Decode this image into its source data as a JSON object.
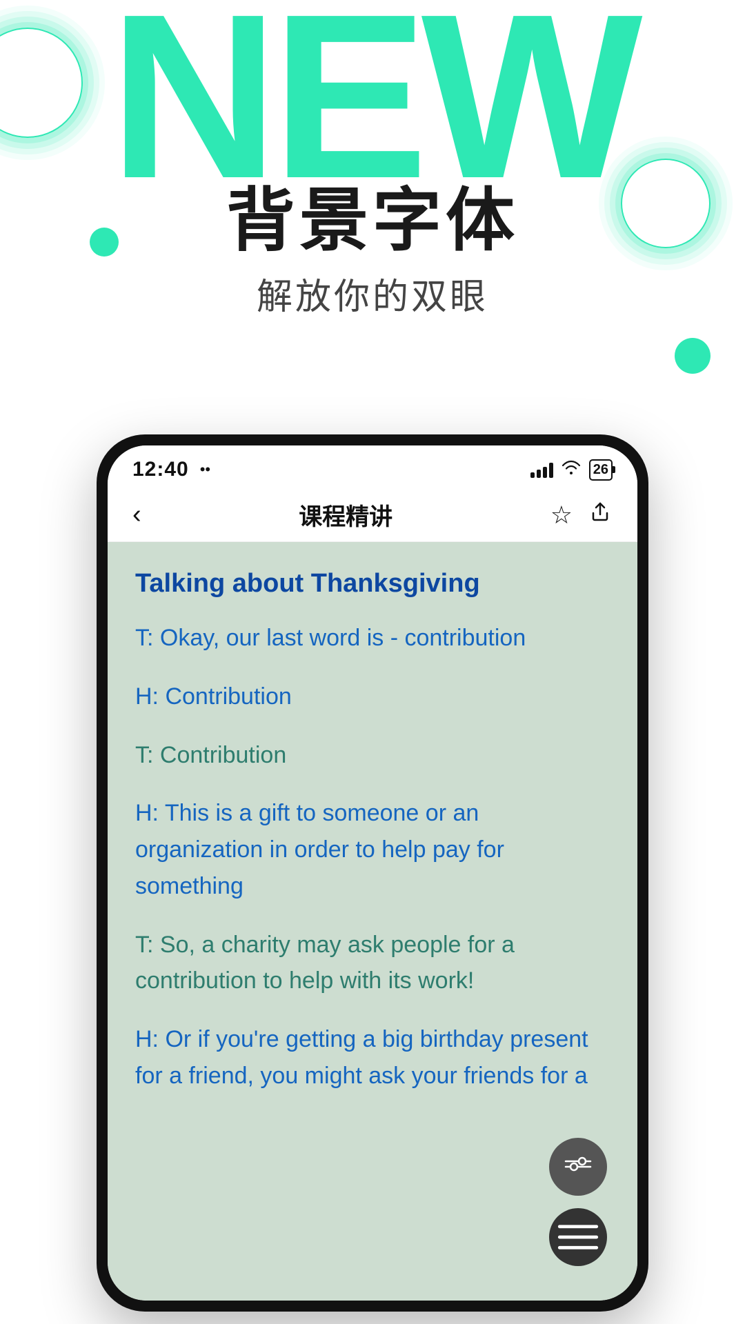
{
  "hero": {
    "new_text": "NEW",
    "title_cn": "背景字体",
    "subtitle_cn": "解放你的双眼"
  },
  "status_bar": {
    "time": "12:40",
    "dots": "••",
    "battery": "26"
  },
  "nav": {
    "title": "课程精讲",
    "back_label": "‹",
    "star_label": "☆",
    "share_label": "↻"
  },
  "lesson": {
    "title": "Talking about Thanksgiving",
    "lines": [
      {
        "id": "line1",
        "text": "T: Okay, our last word is - contribution",
        "style": "blue"
      },
      {
        "id": "line2",
        "text": "H: Contribution",
        "style": "blue"
      },
      {
        "id": "line3",
        "text": "T: Contribution",
        "style": "teal"
      },
      {
        "id": "line4",
        "text": "H: This is a gift to someone or an organization in order to help pay for something",
        "style": "blue"
      },
      {
        "id": "line5",
        "text": "T: So, a charity may ask people for a contribution to help with its work!",
        "style": "teal"
      },
      {
        "id": "line6",
        "text": "H: Or if you're getting a big birthday present for a friend, you might ask your friends for a",
        "style": "blue"
      }
    ]
  },
  "fab": {
    "filter_label": "filter",
    "settings_label": "settings"
  }
}
